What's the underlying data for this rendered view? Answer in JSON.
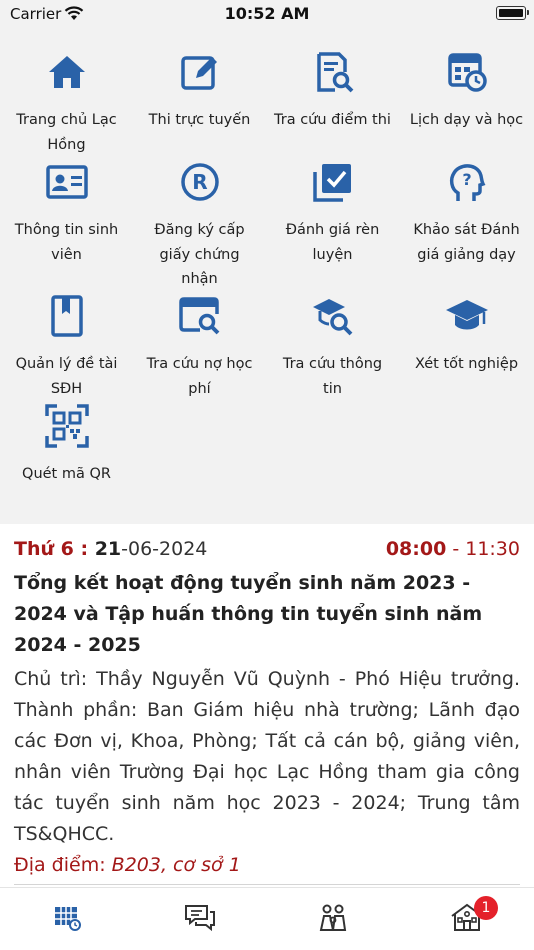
{
  "status_bar": {
    "carrier": "Carrier",
    "time": "10:52 AM"
  },
  "menu": {
    "items": [
      {
        "icon": "home-icon",
        "label": "Trang chủ Lạc Hồng"
      },
      {
        "icon": "edit-icon",
        "label": "Thi trực tuyến"
      },
      {
        "icon": "document-search-icon",
        "label": "Tra cứu điểm thi"
      },
      {
        "icon": "calendar-clock-icon",
        "label": "Lịch dạy và học"
      },
      {
        "icon": "id-card-icon",
        "label": "Thông tin sinh viên"
      },
      {
        "icon": "registered-icon",
        "label": "Đăng ký cấp giấy chứng nhận"
      },
      {
        "icon": "checkbox-icon",
        "label": "Đánh giá rèn luyện"
      },
      {
        "icon": "head-question-icon",
        "label": "Khảo sát Đánh giá giảng dạy"
      },
      {
        "icon": "bookmark-book-icon",
        "label": "Quản lý đề tài SĐH"
      },
      {
        "icon": "window-search-icon",
        "label": "Tra cứu nợ học phí"
      },
      {
        "icon": "graduation-search-icon",
        "label": "Tra cứu thông tin"
      },
      {
        "icon": "graduation-cap-icon",
        "label": "Xét tốt nghiệp"
      },
      {
        "icon": "qr-code-icon",
        "label": "Quét mã QR"
      }
    ]
  },
  "event": {
    "weekday": "Thứ 6 : ",
    "date_day": "21",
    "date_rest": "-06-2024",
    "start_time": "08:00",
    "end_time": " - 11:30",
    "title": "Tổng kết hoạt động tuyển sinh năm 2023 - 2024 và Tập huấn thông tin tuyển sinh năm 2024 - 2025",
    "description": "Chủ trì: Thầy Nguyễn Vũ Quỳnh - Phó Hiệu trưởng. Thành phần: Ban Giám hiệu nhà trường; Lãnh đạo các Đơn vị, Khoa, Phòng; Tất cả cán bộ, giảng viên, nhân viên Trường Đại học Lạc Hồng tham gia công tác tuyển sinh năm học 2023 - 2024; Trung tâm TS&QHCC.",
    "location_label": "Địa điểm: ",
    "location_value": "B203, cơ sở 1"
  },
  "tabbar": {
    "tabs": [
      {
        "icon": "calendar-grid-icon",
        "active": true
      },
      {
        "icon": "chat-icon",
        "active": false
      },
      {
        "icon": "family-icon",
        "active": false
      },
      {
        "icon": "school-icon",
        "active": false,
        "badge": "1"
      }
    ]
  },
  "colors": {
    "accent_blue": "#2a62a8",
    "date_red": "#a31818",
    "badge_red": "#e4212a"
  }
}
